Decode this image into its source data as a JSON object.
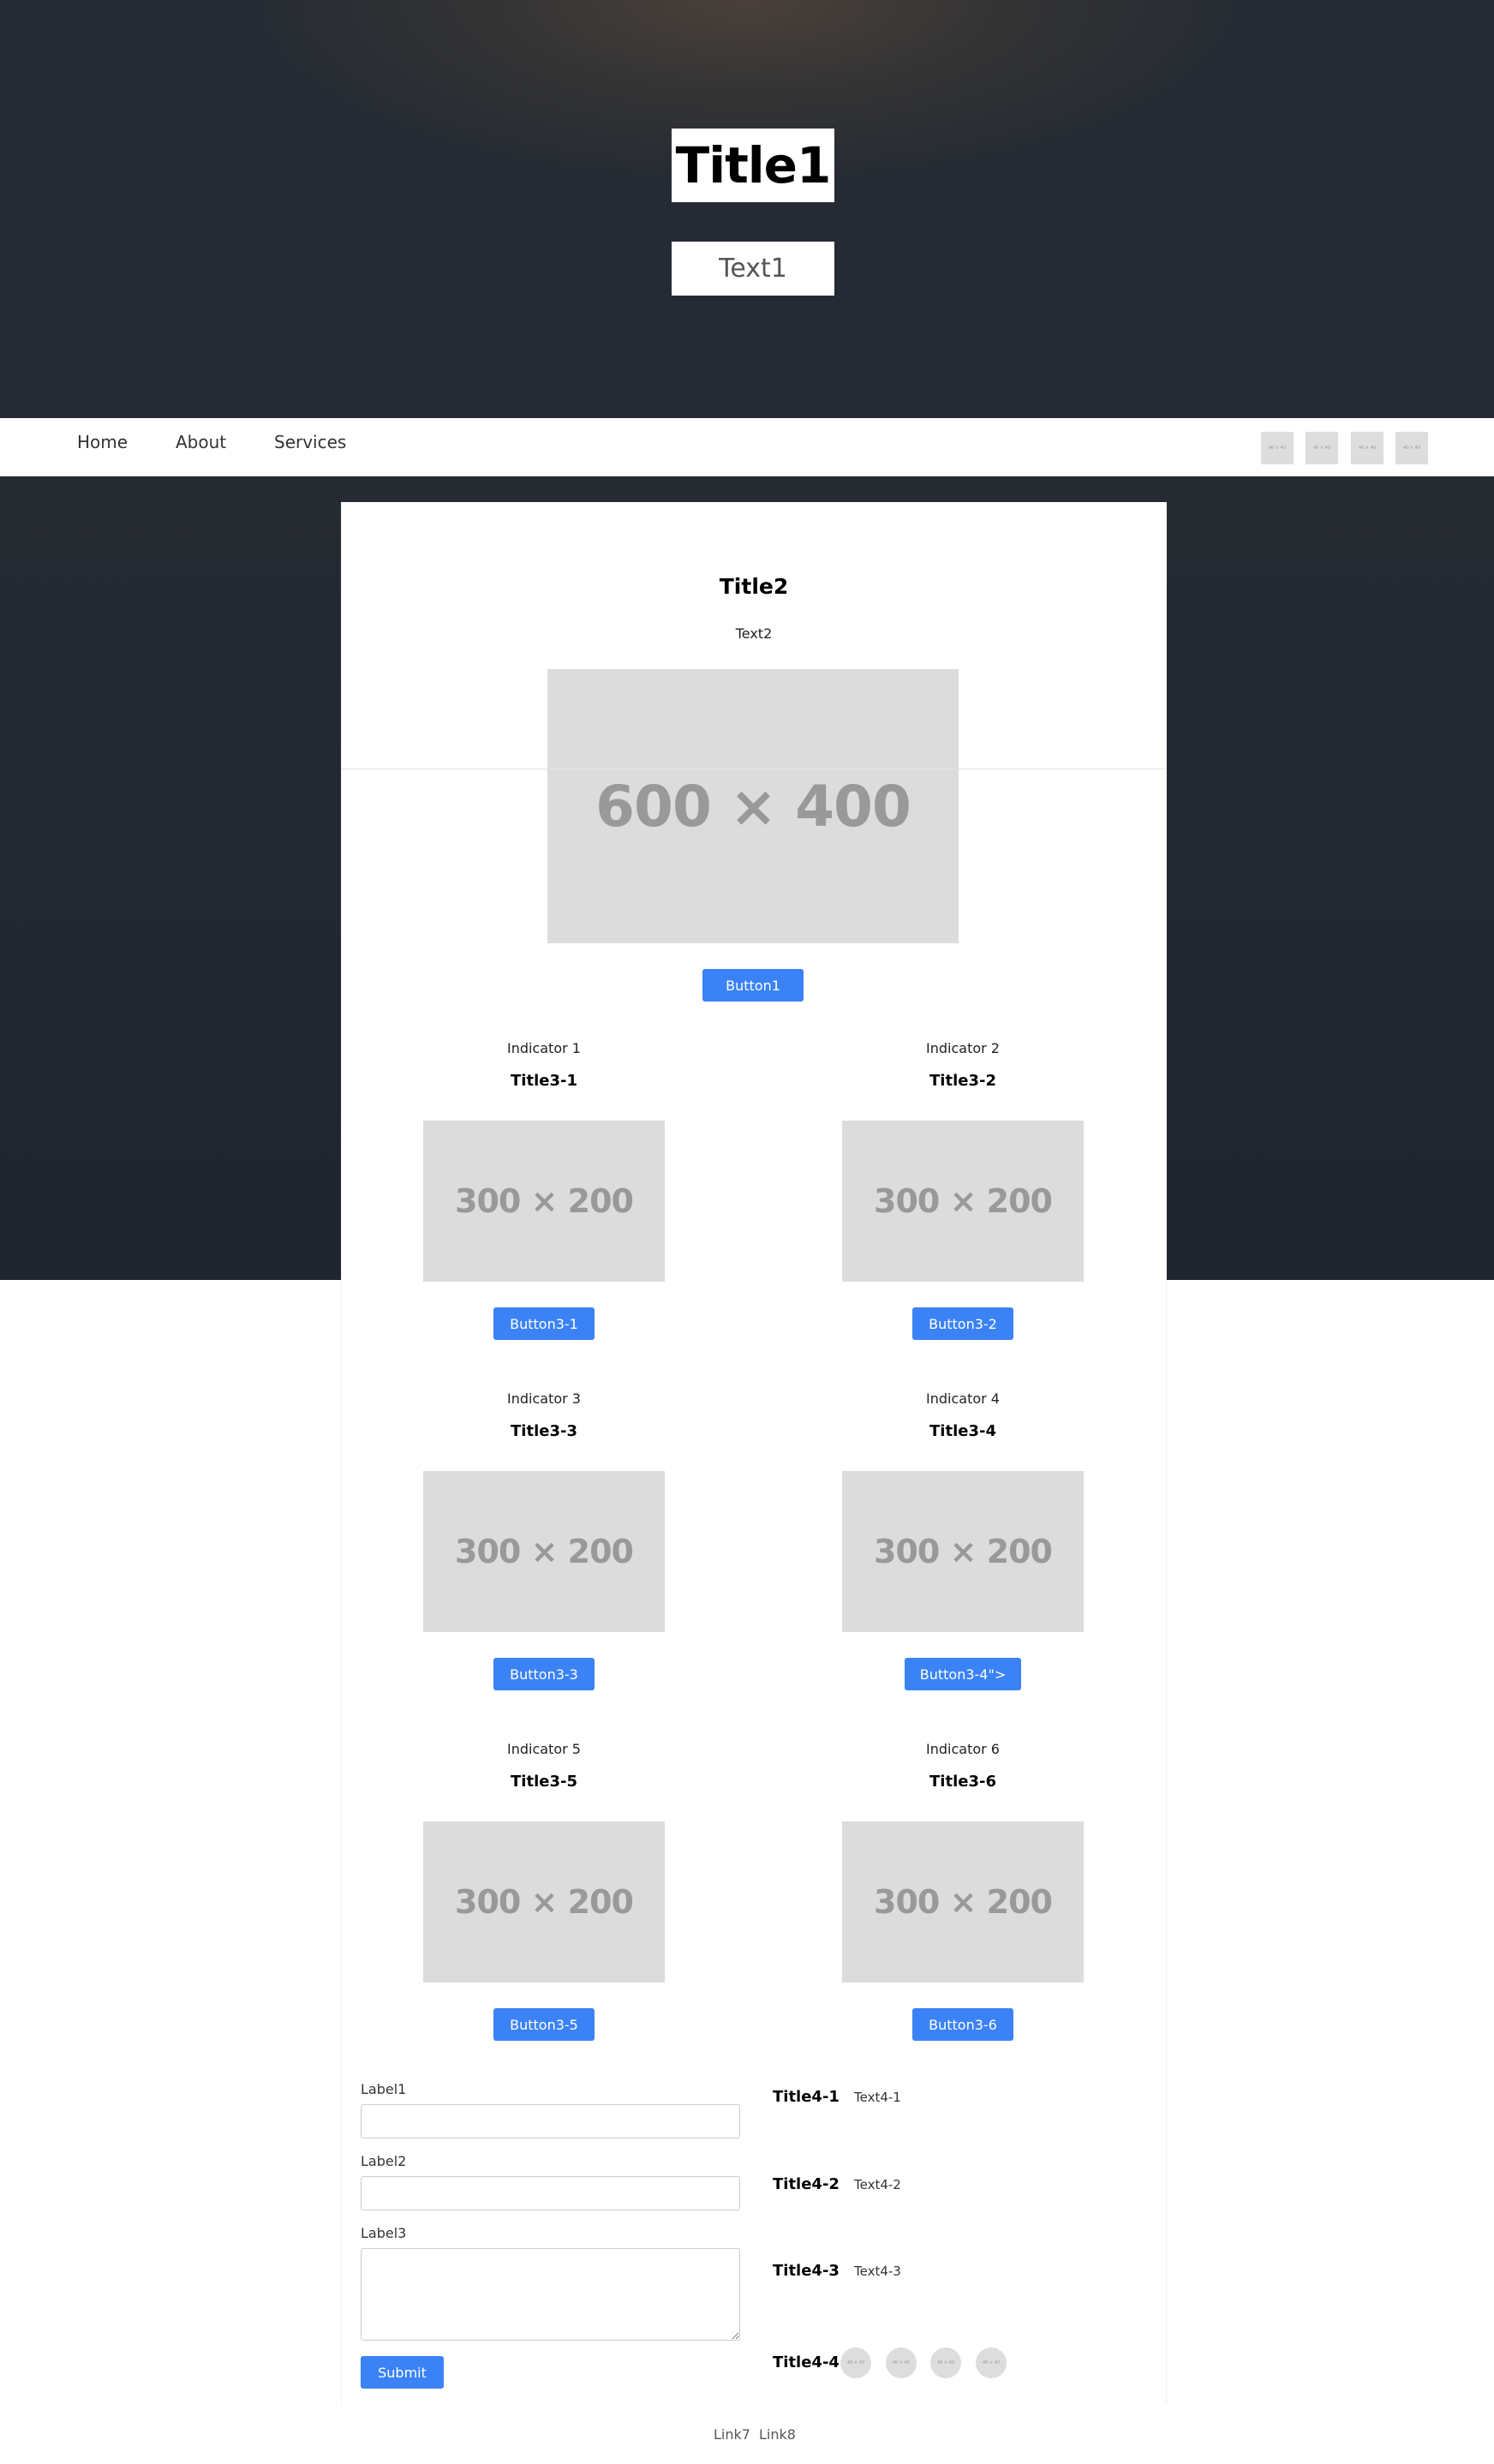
{
  "hero": {
    "title": "Title1",
    "text": "Text1"
  },
  "nav": {
    "links": [
      "Home",
      "About",
      "Services"
    ],
    "thumbnails": [
      "40 × 40",
      "40 × 40",
      "40 × 40",
      "40 × 40"
    ]
  },
  "main": {
    "title": "Title2",
    "text": "Text2",
    "image_label": "600 × 400",
    "button": "Button1"
  },
  "grid": {
    "items": [
      {
        "indicator": "Indicator 1",
        "title": "Title3-1",
        "image_label": "300 × 200",
        "button": "Button3-1"
      },
      {
        "indicator": "Indicator 2",
        "title": "Title3-2",
        "image_label": "300 × 200",
        "button": "Button3-2"
      },
      {
        "indicator": "Indicator 3",
        "title": "Title3-3",
        "image_label": "300 × 200",
        "button": "Button3-3"
      },
      {
        "indicator": "Indicator 4",
        "title": "Title3-4",
        "image_label": "300 × 200",
        "button": "Button3-4\">"
      },
      {
        "indicator": "Indicator 5",
        "title": "Title3-5",
        "image_label": "300 × 200",
        "button": "Button3-5"
      },
      {
        "indicator": "Indicator 6",
        "title": "Title3-6",
        "image_label": "300 × 200",
        "button": "Button3-6"
      }
    ]
  },
  "form": {
    "label1": "Label1",
    "label2": "Label2",
    "label3": "Label3",
    "submit": "Submit"
  },
  "info": {
    "rows": [
      {
        "title": "Title4-1",
        "text": "Text4-1"
      },
      {
        "title": "Title4-2",
        "text": "Text4-2"
      },
      {
        "title": "Title4-3",
        "text": "Text4-3"
      }
    ],
    "social_title": "Title4-4",
    "social_icons": [
      "40 × 40",
      "40 × 40",
      "40 × 40",
      "40 × 40"
    ]
  },
  "footer": {
    "links": [
      "Link7",
      "Link8"
    ]
  },
  "colors": {
    "accent": "#3b82f6",
    "dark_background": "#222731",
    "placeholder": "#dcdcdc"
  }
}
